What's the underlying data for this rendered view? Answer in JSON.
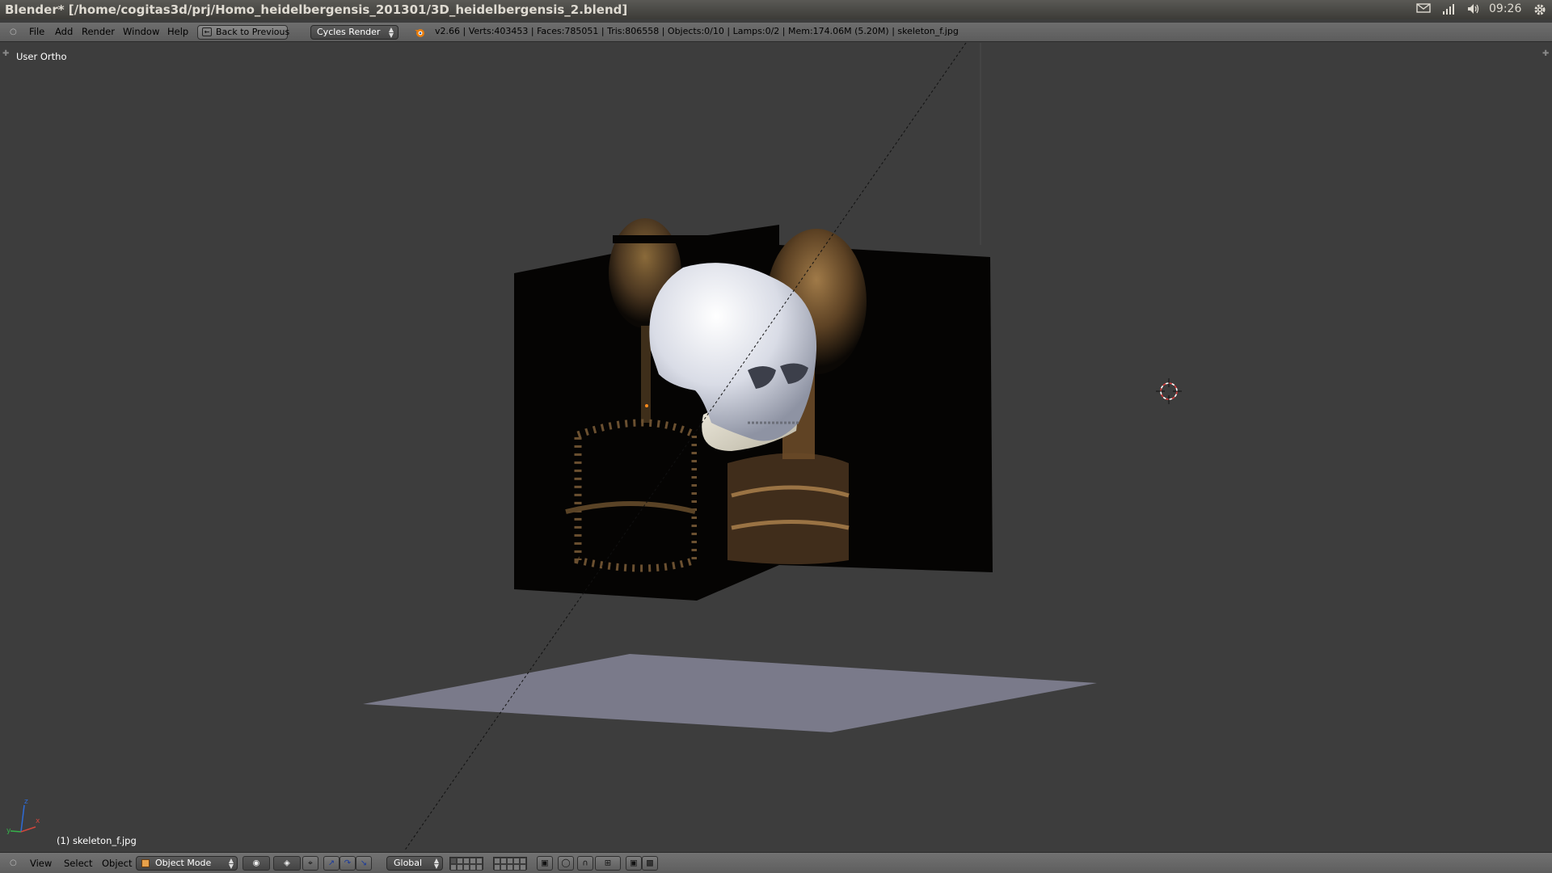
{
  "os_bar": {
    "title": "Blender* [/home/cogitas3d/prj/Homo_heidelbergensis_201301/3D_heidelbergensis_2.blend]",
    "clock": "09:26",
    "indicators": [
      "mail-icon",
      "network-icon",
      "volume-icon",
      "settings-gear-icon"
    ]
  },
  "info_header": {
    "menus": [
      "File",
      "Add",
      "Render",
      "Window",
      "Help"
    ],
    "back_button": "Back to Previous",
    "render_engine": "Cycles Render",
    "stats": "v2.66 | Verts:403453 | Faces:785051 | Tris:806558 | Objects:0/10 | Lamps:0/2 | Mem:174.06M (5.20M) | skeleton_f.jpg"
  },
  "viewport": {
    "view_name": "User Ortho",
    "active_object_label": "(1) skeleton_f.jpg",
    "axes": [
      "y",
      "x",
      "z"
    ]
  },
  "view3d_header": {
    "menus": [
      "View",
      "Select",
      "Object"
    ],
    "mode": "Object Mode",
    "orientation": "Global"
  },
  "colors": {
    "viewport_bg": "#3d3d3d",
    "ground_plane": "#7a7a8a",
    "header_bg": "#6a6a6a",
    "cursor_red": "#d63b3b"
  }
}
